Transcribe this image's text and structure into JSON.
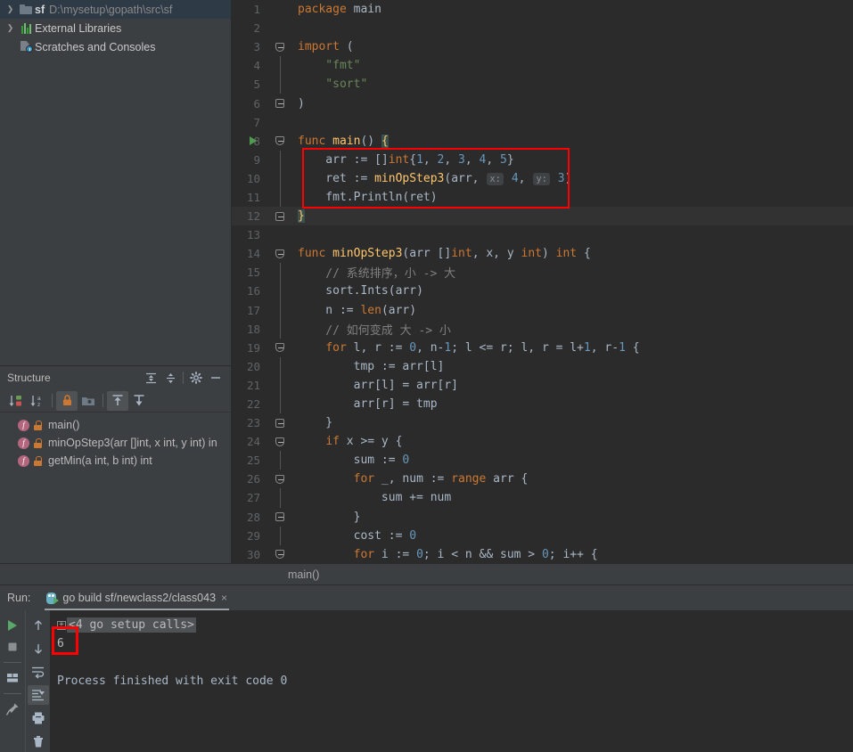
{
  "project_tree": {
    "items": [
      {
        "arrow": "❯",
        "icon": "folder-icon",
        "name": "sf",
        "path": "D:\\mysetup\\gopath\\src\\sf",
        "selected": true
      },
      {
        "arrow": "❯",
        "icon": "library-icon",
        "name": "",
        "path": "External Libraries",
        "selected": false
      },
      {
        "arrow": "",
        "icon": "scratches-icon",
        "name": "",
        "path": "Scratches and Consoles",
        "selected": false
      }
    ]
  },
  "structure": {
    "title": "Structure",
    "header_buttons": [
      {
        "name": "expand-all-button",
        "glyph": "≣"
      },
      {
        "name": "collapse-all-button",
        "glyph": "≡"
      },
      {
        "name": "settings-gear-button",
        "glyph": "⚙"
      },
      {
        "name": "hide-panel-button",
        "glyph": "−"
      }
    ],
    "toolbar_buttons": [
      {
        "name": "sort-by-visibility-button",
        "label": "↓"
      },
      {
        "name": "sort-alphabetically-button",
        "label": "↓"
      },
      {
        "name": "show-non-public-button",
        "label": "lock",
        "active": true
      },
      {
        "name": "group-by-file-button",
        "label": "folder",
        "active": false
      },
      {
        "name": "show-inherited-button",
        "label": "up",
        "active": true
      },
      {
        "name": "show-anonymous-button",
        "label": "down",
        "active": false
      }
    ],
    "items": [
      {
        "label": "main()"
      },
      {
        "label": "minOpStep3(arr []int, x int, y int) in"
      },
      {
        "label": "getMin(a int, b int) int"
      }
    ]
  },
  "editor": {
    "breadcrumb": "main()",
    "lines": [
      {
        "num": "1",
        "tokens": [
          {
            "t": "package ",
            "c": "kw"
          },
          {
            "t": "main",
            "c": "pkgfn"
          }
        ]
      },
      {
        "num": "2",
        "tokens": []
      },
      {
        "num": "3",
        "tokens": [
          {
            "t": "import",
            "c": "kw"
          },
          {
            "t": " (",
            "c": "pkgfn"
          }
        ]
      },
      {
        "num": "4",
        "tokens": [
          {
            "t": "    \"fmt\"",
            "c": "str"
          }
        ]
      },
      {
        "num": "5",
        "tokens": [
          {
            "t": "    \"sort\"",
            "c": "str"
          }
        ]
      },
      {
        "num": "6",
        "tokens": [
          {
            "t": ")",
            "c": "pkgfn"
          }
        ]
      },
      {
        "num": "7",
        "tokens": []
      },
      {
        "num": "8",
        "tokens": [
          {
            "t": "func ",
            "c": "kw"
          },
          {
            "t": "main",
            "c": "fn"
          },
          {
            "t": "() ",
            "c": "pkgfn"
          },
          {
            "t": "{",
            "c": "brace-hl"
          }
        ]
      },
      {
        "num": "9",
        "tokens": [
          {
            "t": "    arr := []",
            "c": "pkgfn"
          },
          {
            "t": "int",
            "c": "kw"
          },
          {
            "t": "{",
            "c": "pkgfn"
          },
          {
            "t": "1",
            "c": "num"
          },
          {
            "t": ", ",
            "c": "pkgfn"
          },
          {
            "t": "2",
            "c": "num"
          },
          {
            "t": ", ",
            "c": "pkgfn"
          },
          {
            "t": "3",
            "c": "num"
          },
          {
            "t": ", ",
            "c": "pkgfn"
          },
          {
            "t": "4",
            "c": "num"
          },
          {
            "t": ", ",
            "c": "pkgfn"
          },
          {
            "t": "5",
            "c": "num"
          },
          {
            "t": "}",
            "c": "pkgfn"
          }
        ]
      },
      {
        "num": "10",
        "tokens": [
          {
            "t": "    ret := ",
            "c": "pkgfn"
          },
          {
            "t": "minOpStep3",
            "c": "fn"
          },
          {
            "t": "(arr, ",
            "c": "pkgfn"
          },
          {
            "t": "x:",
            "c": "hint"
          },
          {
            "t": " ",
            "c": "pkgfn"
          },
          {
            "t": "4",
            "c": "num"
          },
          {
            "t": ", ",
            "c": "pkgfn"
          },
          {
            "t": "y:",
            "c": "hint"
          },
          {
            "t": " ",
            "c": "pkgfn"
          },
          {
            "t": "3",
            "c": "num"
          },
          {
            "t": ")",
            "c": "pkgfn"
          }
        ]
      },
      {
        "num": "11",
        "tokens": [
          {
            "t": "    fmt.",
            "c": "pkgfn"
          },
          {
            "t": "Println",
            "c": "pkgfn"
          },
          {
            "t": "(ret)",
            "c": "pkgfn"
          }
        ]
      },
      {
        "num": "12",
        "tokens": [
          {
            "t": "}",
            "c": "brace-hl"
          }
        ],
        "current": true
      },
      {
        "num": "13",
        "tokens": []
      },
      {
        "num": "14",
        "tokens": [
          {
            "t": "func ",
            "c": "kw"
          },
          {
            "t": "minOpStep3",
            "c": "fn"
          },
          {
            "t": "(arr []",
            "c": "pkgfn"
          },
          {
            "t": "int",
            "c": "kw"
          },
          {
            "t": ", x, y ",
            "c": "pkgfn"
          },
          {
            "t": "int",
            "c": "kw"
          },
          {
            "t": ") ",
            "c": "pkgfn"
          },
          {
            "t": "int",
            "c": "kw"
          },
          {
            "t": " {",
            "c": "pkgfn"
          }
        ]
      },
      {
        "num": "15",
        "tokens": [
          {
            "t": "    // 系统排序，小 -> 大",
            "c": "cmt"
          }
        ]
      },
      {
        "num": "16",
        "tokens": [
          {
            "t": "    sort.",
            "c": "pkgfn"
          },
          {
            "t": "Ints",
            "c": "pkgfn"
          },
          {
            "t": "(arr)",
            "c": "pkgfn"
          }
        ]
      },
      {
        "num": "17",
        "tokens": [
          {
            "t": "    n := ",
            "c": "pkgfn"
          },
          {
            "t": "len",
            "c": "kw"
          },
          {
            "t": "(arr)",
            "c": "pkgfn"
          }
        ]
      },
      {
        "num": "18",
        "tokens": [
          {
            "t": "    // 如何变成 大 -> 小",
            "c": "cmt"
          }
        ]
      },
      {
        "num": "19",
        "tokens": [
          {
            "t": "    ",
            "c": "pkgfn"
          },
          {
            "t": "for",
            "c": "kw"
          },
          {
            "t": " l, r := ",
            "c": "pkgfn"
          },
          {
            "t": "0",
            "c": "num"
          },
          {
            "t": ", n-",
            "c": "pkgfn"
          },
          {
            "t": "1",
            "c": "num"
          },
          {
            "t": "; l <= r; l, r = l+",
            "c": "pkgfn"
          },
          {
            "t": "1",
            "c": "num"
          },
          {
            "t": ", r-",
            "c": "pkgfn"
          },
          {
            "t": "1",
            "c": "num"
          },
          {
            "t": " {",
            "c": "pkgfn"
          }
        ]
      },
      {
        "num": "20",
        "tokens": [
          {
            "t": "        tmp := arr[l]",
            "c": "pkgfn"
          }
        ]
      },
      {
        "num": "21",
        "tokens": [
          {
            "t": "        arr[l] = arr[r]",
            "c": "pkgfn"
          }
        ]
      },
      {
        "num": "22",
        "tokens": [
          {
            "t": "        arr[r] = tmp",
            "c": "pkgfn"
          }
        ]
      },
      {
        "num": "23",
        "tokens": [
          {
            "t": "    }",
            "c": "pkgfn"
          }
        ]
      },
      {
        "num": "24",
        "tokens": [
          {
            "t": "    ",
            "c": "pkgfn"
          },
          {
            "t": "if",
            "c": "kw"
          },
          {
            "t": " x >= y {",
            "c": "pkgfn"
          }
        ]
      },
      {
        "num": "25",
        "tokens": [
          {
            "t": "        sum := ",
            "c": "pkgfn"
          },
          {
            "t": "0",
            "c": "num"
          }
        ]
      },
      {
        "num": "26",
        "tokens": [
          {
            "t": "        ",
            "c": "pkgfn"
          },
          {
            "t": "for",
            "c": "kw"
          },
          {
            "t": " _, num := ",
            "c": "pkgfn"
          },
          {
            "t": "range",
            "c": "kw"
          },
          {
            "t": " arr {",
            "c": "pkgfn"
          }
        ]
      },
      {
        "num": "27",
        "tokens": [
          {
            "t": "            sum += num",
            "c": "pkgfn"
          }
        ]
      },
      {
        "num": "28",
        "tokens": [
          {
            "t": "        }",
            "c": "pkgfn"
          }
        ]
      },
      {
        "num": "29",
        "tokens": [
          {
            "t": "        cost := ",
            "c": "pkgfn"
          },
          {
            "t": "0",
            "c": "num"
          }
        ]
      },
      {
        "num": "30",
        "tokens": [
          {
            "t": "        ",
            "c": "pkgfn"
          },
          {
            "t": "for",
            "c": "kw"
          },
          {
            "t": " i := ",
            "c": "pkgfn"
          },
          {
            "t": "0",
            "c": "num"
          },
          {
            "t": "; i < n && sum > ",
            "c": "pkgfn"
          },
          {
            "t": "0",
            "c": "num"
          },
          {
            "t": "; i++ {",
            "c": "pkgfn"
          }
        ]
      }
    ]
  },
  "run": {
    "label": "Run:",
    "tab_title": "go build sf/newclass2/class043",
    "close_glyph": "×",
    "toolbar_left": [
      {
        "name": "rerun-button",
        "glyph": "run"
      },
      {
        "name": "stop-button",
        "glyph": "stop"
      },
      {
        "name": "layout-button",
        "glyph": "layout"
      },
      {
        "name": "pin-tab-button",
        "glyph": "pin"
      }
    ],
    "toolbar_right": [
      {
        "name": "up-stack-button",
        "glyph": "↑"
      },
      {
        "name": "down-stack-button",
        "glyph": "↓"
      },
      {
        "name": "soft-wrap-button",
        "glyph": "wrap"
      },
      {
        "name": "scroll-to-end-button",
        "glyph": "scrollend",
        "active": true
      },
      {
        "name": "print-button",
        "glyph": "print"
      },
      {
        "name": "clear-all-button",
        "glyph": "trash"
      }
    ],
    "console": {
      "fold_glyph": "+",
      "setup_calls": "<4 go setup calls>",
      "output_value": "6",
      "exit_message": "Process finished with exit code 0"
    }
  },
  "colors": {
    "annotation_red": "#ff0000",
    "editor_bg": "#2b2b2b",
    "panel_bg": "#3c3f41",
    "selection_blue": "#2f3a47",
    "keyword_orange": "#cc7832",
    "string_green": "#6a8759",
    "number_blue": "#6897bb",
    "function_yellow": "#ffc66d",
    "comment_gray": "#808080",
    "text_default": "#a9b7c6"
  }
}
